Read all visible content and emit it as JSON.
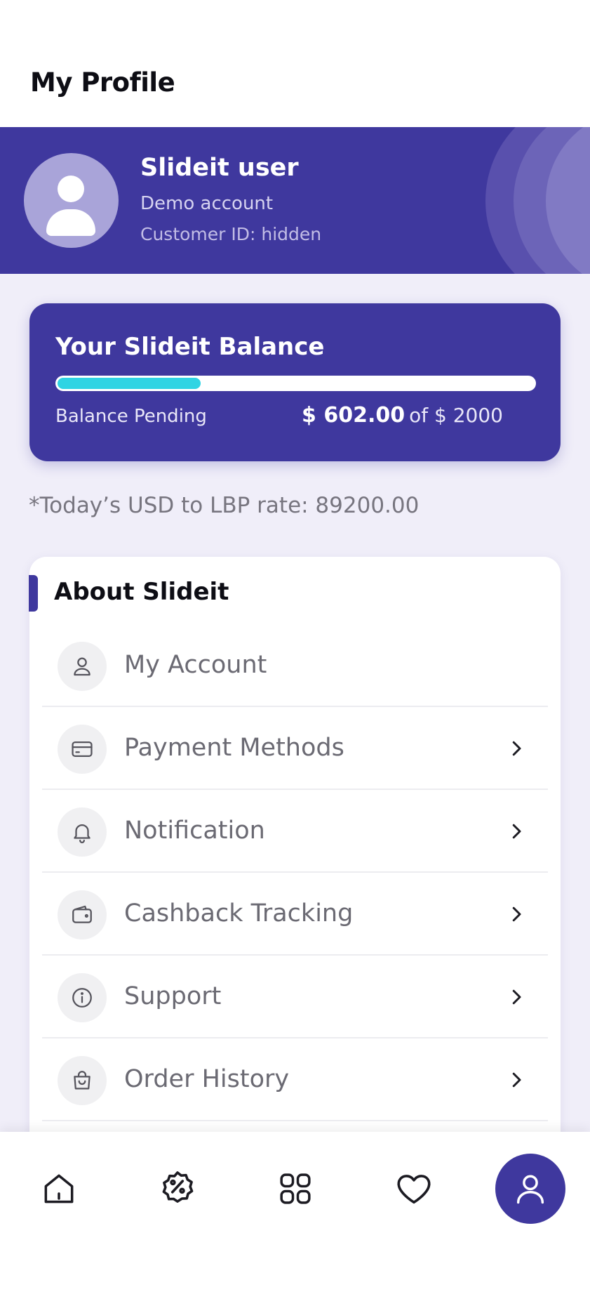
{
  "header": {
    "title": "My Profile"
  },
  "profile": {
    "name": "Slideit user",
    "subtitle": "Demo account",
    "customer_id": "Customer ID: hidden",
    "avatar_icon": "user-avatar-icon"
  },
  "balance": {
    "title": "Your Slideit Balance",
    "label": "Balance Pending",
    "amount": "$ 602.00",
    "limit_text": "of $ 2000",
    "used_fraction": 0.301,
    "bar_color": "#2fd4e3"
  },
  "rate_note": "*Today’s USD to LBP rate: 89200.00",
  "about": {
    "title": "About Slideit",
    "items": [
      {
        "label": "My Account",
        "icon": "user-icon",
        "chevron": false
      },
      {
        "label": "Payment Methods",
        "icon": "credit-card-icon",
        "chevron": true
      },
      {
        "label": "Notification",
        "icon": "bell-icon",
        "chevron": true
      },
      {
        "label": "Cashback Tracking",
        "icon": "wallet-icon",
        "chevron": true
      },
      {
        "label": "Support",
        "icon": "info-icon",
        "chevron": true
      },
      {
        "label": "Order History",
        "icon": "shopping-bag-icon",
        "chevron": true
      }
    ]
  },
  "nav": {
    "items": [
      {
        "name": "home",
        "icon": "home-icon"
      },
      {
        "name": "offers",
        "icon": "discount-badge-icon"
      },
      {
        "name": "categories",
        "icon": "grid-icon"
      },
      {
        "name": "favorites",
        "icon": "heart-icon"
      },
      {
        "name": "profile",
        "icon": "profile-icon",
        "active": true
      }
    ]
  },
  "colors": {
    "brand": "#3f389e",
    "accent": "#2fd4e3",
    "background": "#f0eef9"
  }
}
